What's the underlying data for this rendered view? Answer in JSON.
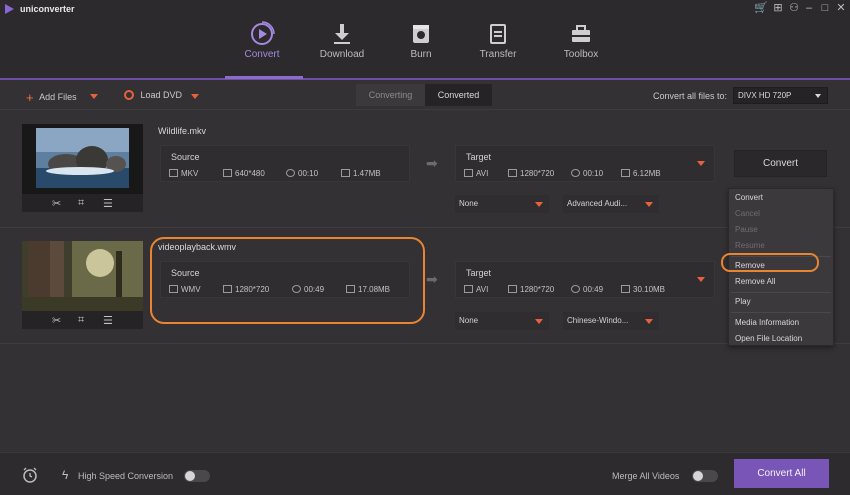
{
  "app": {
    "title": "uniconverter"
  },
  "colors": {
    "accent": "#8a6cc9",
    "highlight": "#e88532",
    "arrow": "#e8603c"
  },
  "nav": [
    {
      "label": "Convert",
      "icon": "convert-play-icon",
      "active": true
    },
    {
      "label": "Download",
      "icon": "download-icon"
    },
    {
      "label": "Burn",
      "icon": "burn-disc-icon"
    },
    {
      "label": "Transfer",
      "icon": "transfer-icon"
    },
    {
      "label": "Toolbox",
      "icon": "toolbox-icon"
    }
  ],
  "toolbar": {
    "add_files": "Add Files",
    "load_dvd": "Load DVD",
    "tab_converting": "Converting",
    "tab_converted": "Converted",
    "convert_all_to": "Convert all files to:",
    "format": "DIVX HD 720P"
  },
  "files": [
    {
      "name": "Wildlife.mkv",
      "source": {
        "caption": "Source",
        "format": "MKV",
        "resolution": "640*480",
        "duration": "00:10",
        "size": "1.47MB"
      },
      "target": {
        "caption": "Target",
        "format": "AVI",
        "resolution": "1280*720",
        "duration": "00:10",
        "size": "6.12MB"
      },
      "subtitle": "None",
      "audio": "Advanced Audi..."
    },
    {
      "name": "videoplayback.wmv",
      "source": {
        "caption": "Source",
        "format": "WMV",
        "resolution": "1280*720",
        "duration": "00:49",
        "size": "17.08MB"
      },
      "target": {
        "caption": "Target",
        "format": "AVI",
        "resolution": "1280*720",
        "duration": "00:49",
        "size": "30.10MB"
      },
      "subtitle": "None",
      "audio": "Chinese-Windo..."
    }
  ],
  "convert_button": "Convert",
  "context_menu": {
    "convert": "Convert",
    "cancel": "Cancel",
    "pause": "Pause",
    "resume": "Resume",
    "remove": "Remove",
    "remove_all": "Remove All",
    "play": "Play",
    "media_information": "Media Information",
    "open_file_location": "Open File Location"
  },
  "bottom": {
    "high_speed": "High Speed Conversion",
    "merge_all": "Merge All Videos",
    "convert_all": "Convert All"
  }
}
